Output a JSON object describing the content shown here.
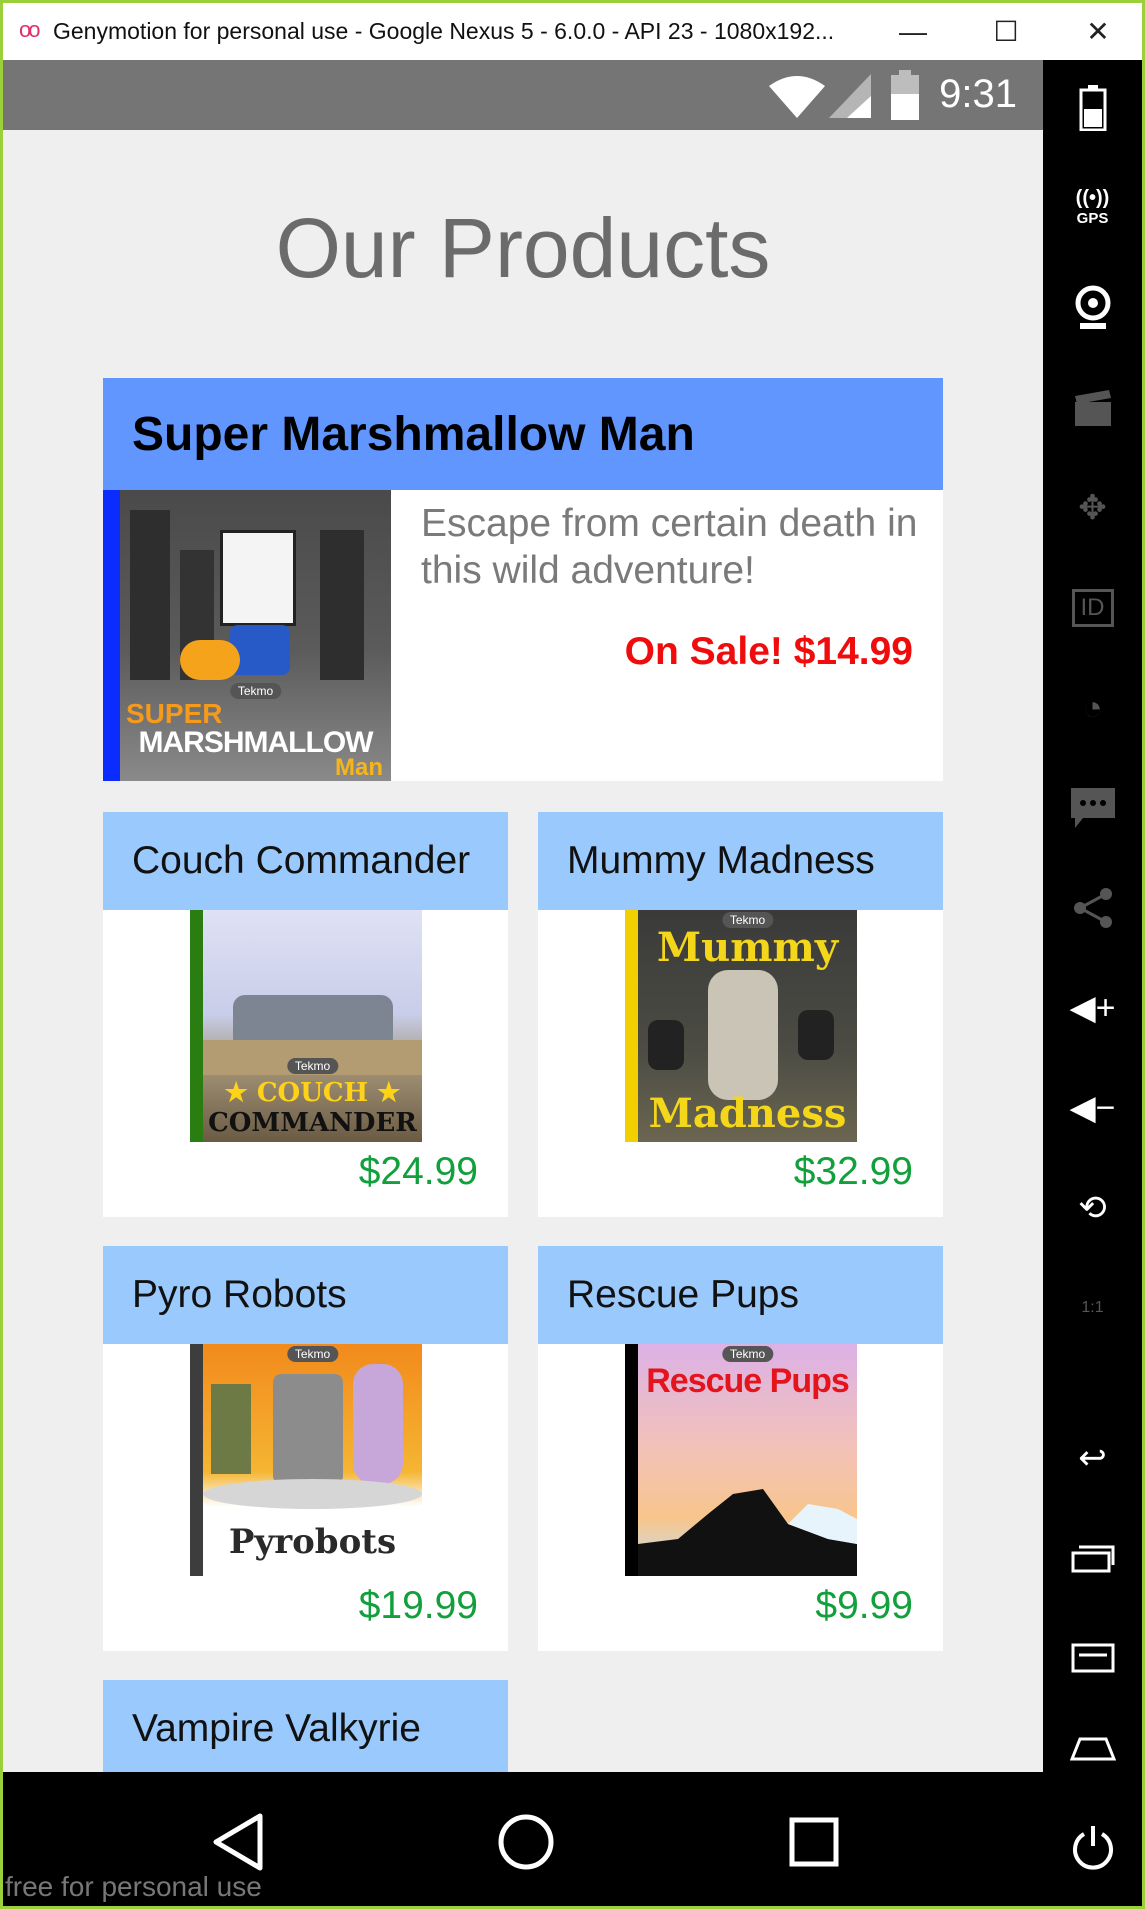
{
  "window": {
    "title": "Genymotion for personal use - Google Nexus 5 - 6.0.0 - API 23 - 1080x192...",
    "logo": "oo",
    "minimize_icon": "—",
    "maximize_icon": "☐",
    "close_icon": "✕"
  },
  "status_bar": {
    "time": "9:31"
  },
  "page": {
    "heading": "Our Products"
  },
  "featured": {
    "name": "Super Marshmallow Man",
    "description": "Escape from certain death in this wild adventure!",
    "price": "On Sale! $14.99",
    "cover": {
      "brand": "Tekmo",
      "line1": "SUPER",
      "line2": "MARSHMALLOW",
      "line3": "Man"
    },
    "accent_color": "#0a2cff"
  },
  "products": [
    {
      "name": "Couch Commander",
      "price": "$24.99",
      "cover": {
        "brand": "Tekmo",
        "line1": "★ COUCH ★",
        "line2": "COMMANDER"
      },
      "accent_color": "#2a7d10"
    },
    {
      "name": "Mummy Madness",
      "price": "$32.99",
      "cover": {
        "brand": "Tekmo",
        "line1": "Mummy",
        "line2": "Madness"
      },
      "accent_color": "#f2d000"
    },
    {
      "name": "Pyro Robots",
      "price": "$19.99",
      "cover": {
        "brand": "Tekmo",
        "line1": "Pyrobots"
      },
      "accent_color": "#3d3d3d"
    },
    {
      "name": "Rescue Pups",
      "price": "$9.99",
      "cover": {
        "brand": "Tekmo",
        "line1": "Rescue Pups"
      },
      "accent_color": "#000000"
    },
    {
      "name": "Vampire Valkyrie"
    }
  ],
  "side_toolbar": {
    "gps_label": "GPS",
    "id_label": "ID",
    "pixel_label": "1:1"
  },
  "watermark": "free for personal use"
}
